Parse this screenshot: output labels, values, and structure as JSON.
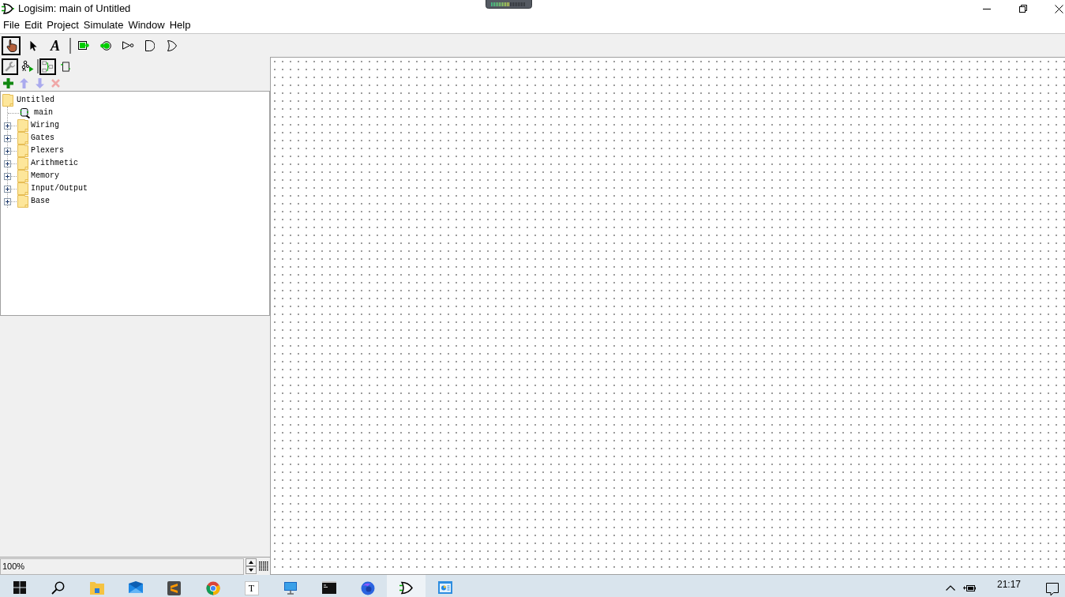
{
  "window": {
    "title": "Logisim: main of Untitled"
  },
  "menu_bar": [
    "File",
    "Edit",
    "Project",
    "Simulate",
    "Window",
    "Help"
  ],
  "toolbar": [
    [
      {
        "kind": "hand",
        "selected": true
      },
      {
        "kind": "arrow",
        "selected": false
      },
      {
        "kind": "text",
        "label": "A",
        "selected": false
      }
    ],
    [
      {
        "kind": "input_pin",
        "selected": false
      },
      {
        "kind": "output_pin",
        "selected": false
      },
      {
        "kind": "not_gate",
        "selected": false
      },
      {
        "kind": "and_gate",
        "selected": false
      },
      {
        "kind": "or_gate",
        "selected": false
      }
    ]
  ],
  "explorer_toolbar": [
    [
      {
        "kind": "toolbox",
        "selected": true
      },
      {
        "kind": "simulation",
        "selected": false
      }
    ],
    [
      {
        "kind": "layout",
        "selected": true
      },
      {
        "kind": "appearance",
        "selected": false
      }
    ]
  ],
  "circuit_actions": [
    {
      "kind": "add",
      "disabled": false
    },
    {
      "kind": "move_up",
      "disabled": true
    },
    {
      "kind": "move_down",
      "disabled": true
    },
    {
      "kind": "remove",
      "disabled": true
    }
  ],
  "project_tree": [
    {
      "kind": "project",
      "label": "Untitled",
      "children": [
        {
          "kind": "circuit",
          "label": "main"
        },
        {
          "kind": "library",
          "label": "Wiring",
          "expanded": false
        },
        {
          "kind": "library",
          "label": "Gates",
          "expanded": false
        },
        {
          "kind": "library",
          "label": "Plexers",
          "expanded": false
        },
        {
          "kind": "library",
          "label": "Arithmetic",
          "expanded": false
        },
        {
          "kind": "library",
          "label": "Memory",
          "expanded": false
        },
        {
          "kind": "library",
          "label": "Input/Output",
          "expanded": false
        },
        {
          "kind": "library",
          "label": "Base",
          "expanded": false
        }
      ]
    }
  ],
  "zoom": {
    "value": "100%"
  },
  "taskbar": {
    "apps": [
      {
        "kind": "start",
        "selected": false
      },
      {
        "kind": "search",
        "selected": false
      },
      {
        "kind": "folder",
        "selected": false
      },
      {
        "kind": "mail",
        "selected": false
      },
      {
        "kind": "editor",
        "selected": false
      },
      {
        "kind": "browser",
        "selected": false
      },
      {
        "kind": "letter_tile",
        "label": "T",
        "selected": false
      },
      {
        "kind": "monitor",
        "selected": false
      },
      {
        "kind": "terminal",
        "selected": false
      },
      {
        "kind": "globe",
        "selected": false
      },
      {
        "kind": "gate",
        "selected": true
      },
      {
        "kind": "control_panel",
        "selected": false
      }
    ],
    "clock": {
      "time": "21:17"
    }
  }
}
